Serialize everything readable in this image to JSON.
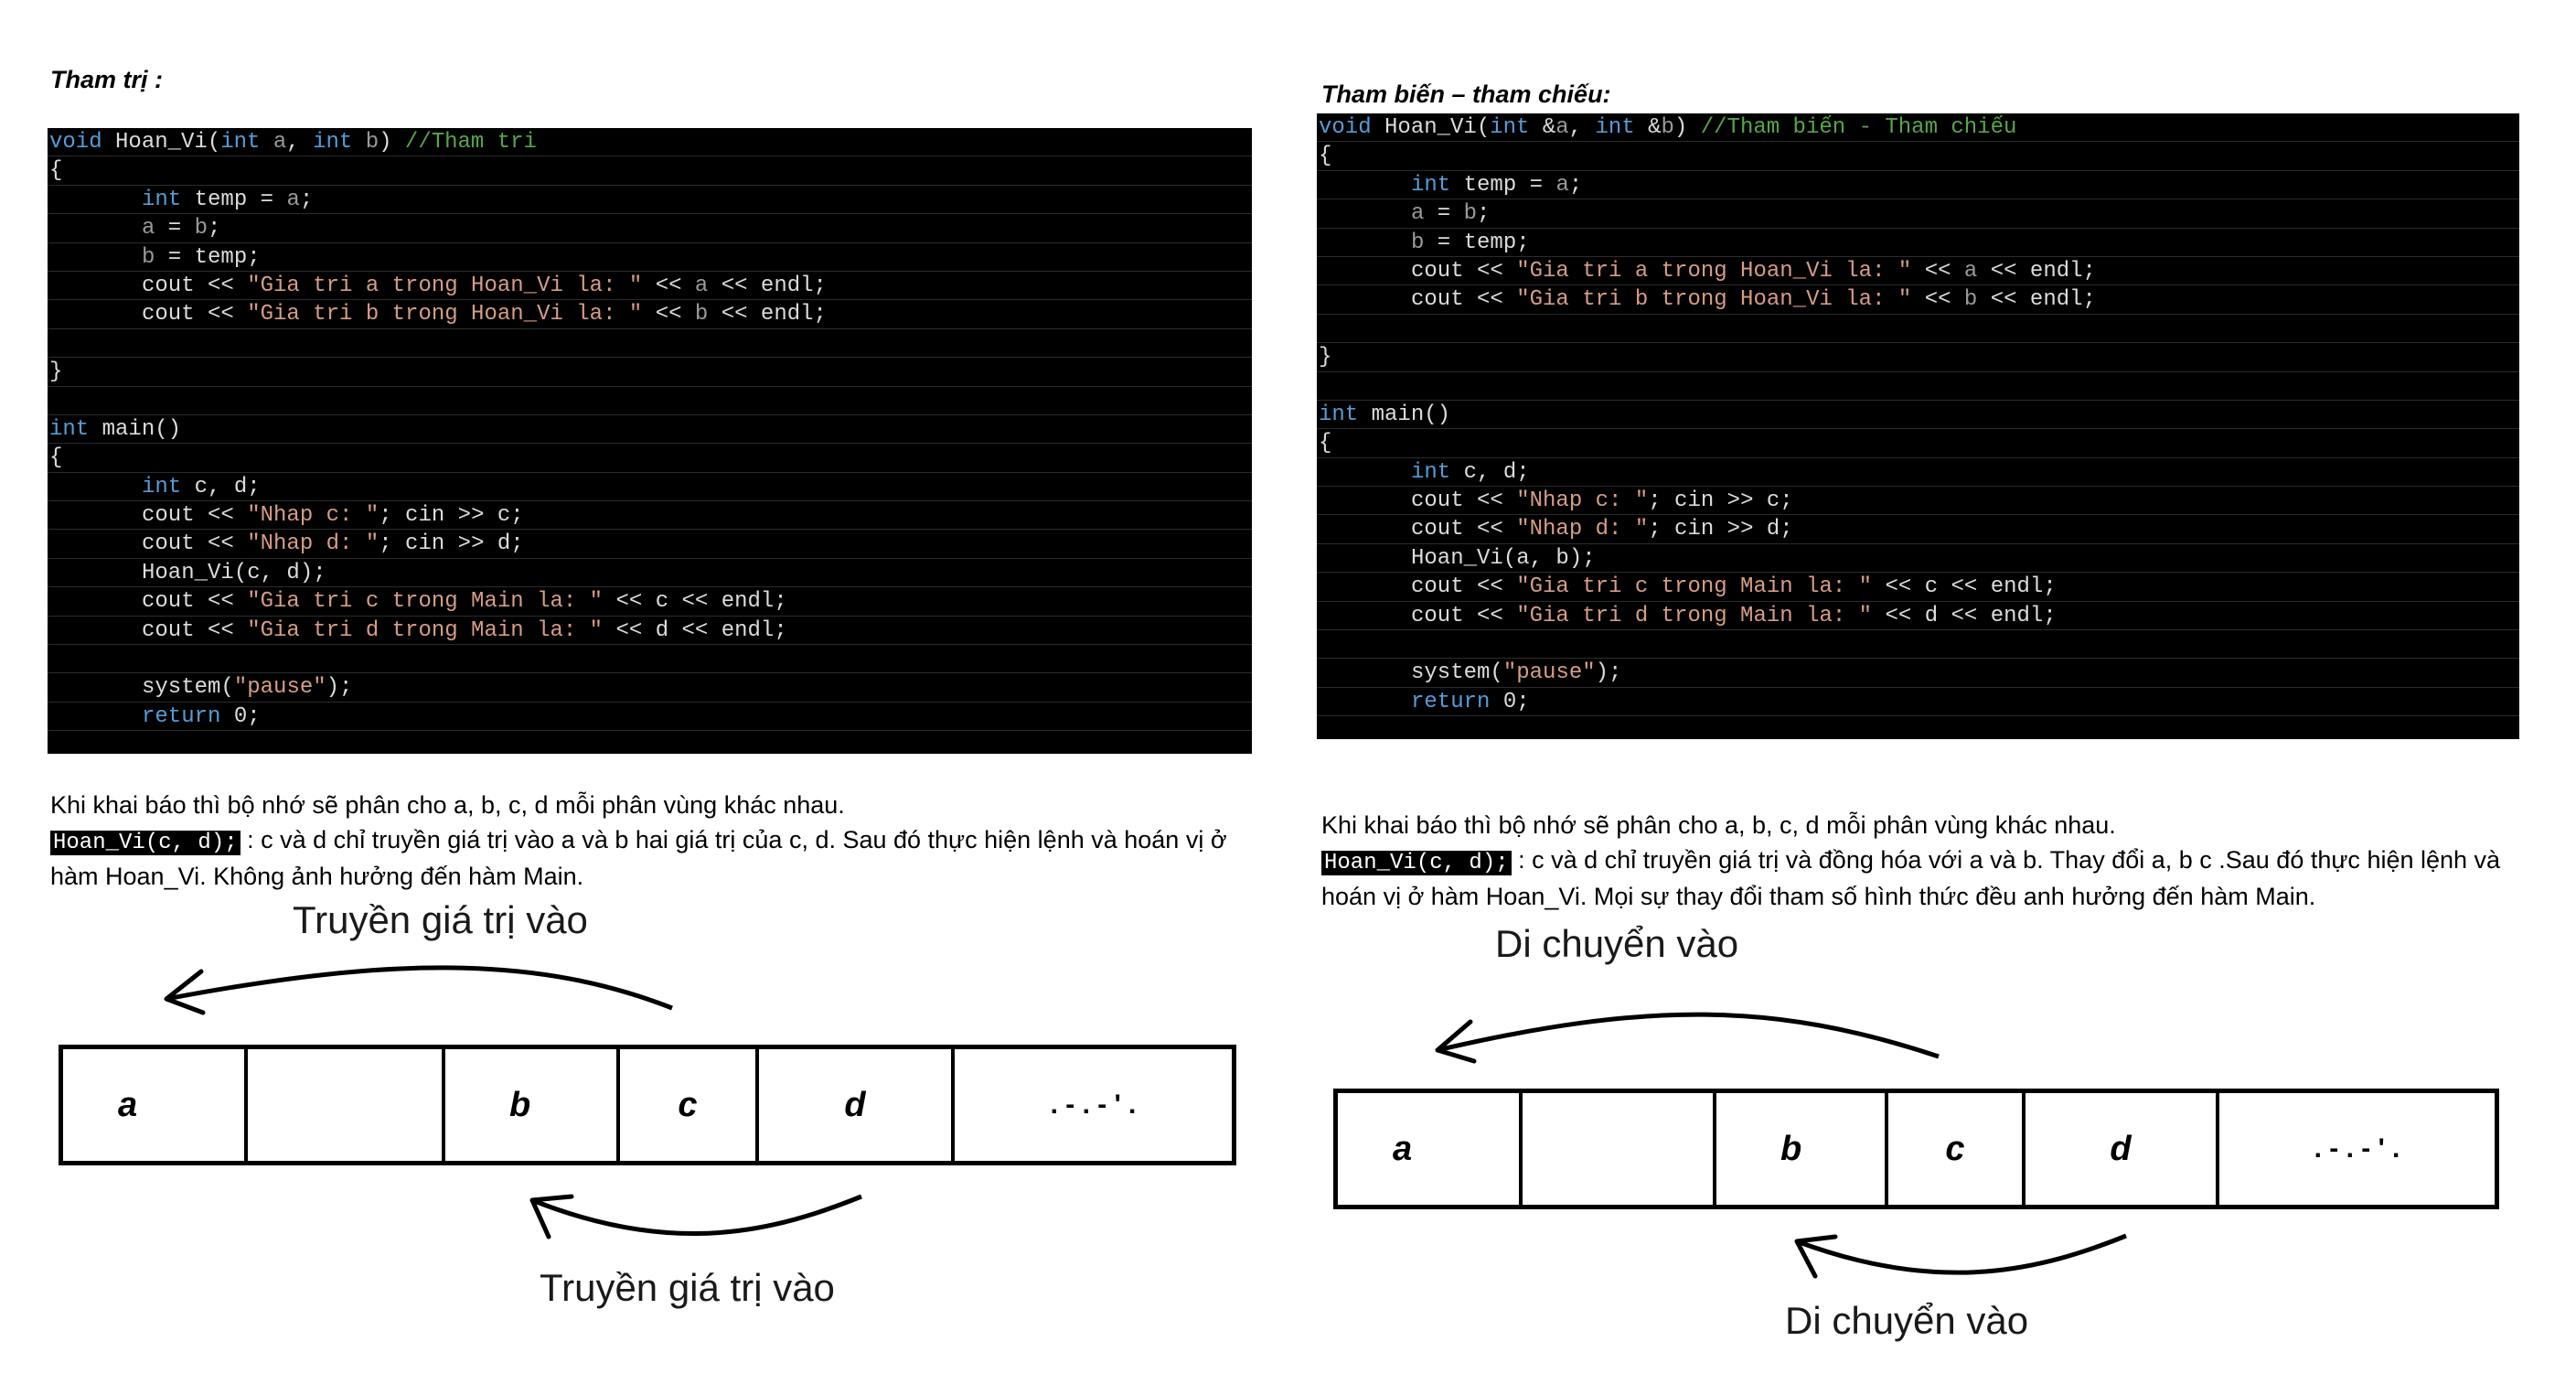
{
  "left": {
    "heading": "Tham trị :",
    "code": [
      [
        {
          "t": "void",
          "c": "kw"
        },
        {
          "t": " Hoan_Vi("
        },
        {
          "t": "int",
          "c": "kw"
        },
        {
          "t": " "
        },
        {
          "t": "a",
          "c": "par"
        },
        {
          "t": ", "
        },
        {
          "t": "int",
          "c": "kw"
        },
        {
          "t": " "
        },
        {
          "t": "b",
          "c": "par"
        },
        {
          "t": ") "
        },
        {
          "t": "//Tham tri",
          "c": "cmt"
        }
      ],
      [
        {
          "t": "{"
        }
      ],
      [
        {
          "t": "int",
          "c": "kw",
          "i": 1
        },
        {
          "t": " temp = "
        },
        {
          "t": "a",
          "c": "par"
        },
        {
          "t": ";"
        }
      ],
      [
        {
          "t": "a",
          "c": "par",
          "i": 1
        },
        {
          "t": " = "
        },
        {
          "t": "b",
          "c": "par"
        },
        {
          "t": ";"
        }
      ],
      [
        {
          "t": "b",
          "c": "par",
          "i": 1
        },
        {
          "t": " = temp;"
        }
      ],
      [
        {
          "t": "cout << ",
          "i": 1
        },
        {
          "t": "\"Gia tri a trong Hoan_Vi la: \"",
          "c": "str"
        },
        {
          "t": " << "
        },
        {
          "t": "a",
          "c": "par"
        },
        {
          "t": " << endl;"
        }
      ],
      [
        {
          "t": "cout << ",
          "i": 1
        },
        {
          "t": "\"Gia tri b trong Hoan_Vi la: \"",
          "c": "str"
        },
        {
          "t": " << "
        },
        {
          "t": "b",
          "c": "par"
        },
        {
          "t": " << endl;"
        }
      ],
      [
        {
          "t": ""
        }
      ],
      [
        {
          "t": "}"
        }
      ],
      [
        {
          "t": ""
        }
      ],
      [
        {
          "t": "int",
          "c": "kw"
        },
        {
          "t": " main()"
        }
      ],
      [
        {
          "t": "{"
        }
      ],
      [
        {
          "t": "int",
          "c": "kw",
          "i": 1
        },
        {
          "t": " c, d;"
        }
      ],
      [
        {
          "t": "cout << ",
          "i": 1
        },
        {
          "t": "\"Nhap c: \"",
          "c": "str"
        },
        {
          "t": "; cin >> c;"
        }
      ],
      [
        {
          "t": "cout << ",
          "i": 1
        },
        {
          "t": "\"Nhap d: \"",
          "c": "str"
        },
        {
          "t": "; cin >> d;"
        }
      ],
      [
        {
          "t": "Hoan_Vi(c, d);",
          "i": 1
        }
      ],
      [
        {
          "t": "cout << ",
          "i": 1
        },
        {
          "t": "\"Gia tri c trong Main la: \"",
          "c": "str"
        },
        {
          "t": " << c << endl;"
        }
      ],
      [
        {
          "t": "cout << ",
          "i": 1
        },
        {
          "t": "\"Gia tri d trong Main la: \"",
          "c": "str"
        },
        {
          "t": " << d << endl;"
        }
      ],
      [
        {
          "t": ""
        }
      ],
      [
        {
          "t": "system(",
          "i": 1
        },
        {
          "t": "\"pause\"",
          "c": "str"
        },
        {
          "t": ");"
        }
      ],
      [
        {
          "t": "return",
          "c": "kw",
          "i": 1
        },
        {
          "t": " 0;"
        }
      ]
    ],
    "para_line1": "Khi khai báo thì bộ nhớ sẽ phân cho a, b, c, d mỗi phân vùng khác nhau.",
    "para_code": "Hoan_Vi(c, d);",
    "para_rest": " : c và d chỉ truyền giá trị vào a và b hai giá trị của c, d. Sau đó thực hiện lệnh và hoán vị ở hàm Hoan_Vi. Không ảnh hưởng đến hàm Main.",
    "label_top": "Truyền giá trị vào",
    "label_bottom": "Truyền giá trị vào",
    "cells": [
      "a",
      "",
      "b",
      "c",
      "d",
      ". - . - ' ."
    ]
  },
  "right": {
    "heading": "Tham biến – tham chiếu:",
    "code": [
      [
        {
          "t": "void",
          "c": "kw"
        },
        {
          "t": " Hoan_Vi("
        },
        {
          "t": "int",
          "c": "kw"
        },
        {
          "t": " &"
        },
        {
          "t": "a",
          "c": "par"
        },
        {
          "t": ", "
        },
        {
          "t": "int",
          "c": "kw"
        },
        {
          "t": " &"
        },
        {
          "t": "b",
          "c": "par"
        },
        {
          "t": ") "
        },
        {
          "t": "//Tham biến - Tham chiếu",
          "c": "cmt"
        }
      ],
      [
        {
          "t": "{"
        }
      ],
      [
        {
          "t": "int",
          "c": "kw",
          "i": 1
        },
        {
          "t": " temp = "
        },
        {
          "t": "a",
          "c": "par"
        },
        {
          "t": ";"
        }
      ],
      [
        {
          "t": "a",
          "c": "par",
          "i": 1
        },
        {
          "t": " = "
        },
        {
          "t": "b",
          "c": "par"
        },
        {
          "t": ";"
        }
      ],
      [
        {
          "t": "b",
          "c": "par",
          "i": 1
        },
        {
          "t": " = temp;"
        }
      ],
      [
        {
          "t": "cout << ",
          "i": 1
        },
        {
          "t": "\"Gia tri a trong Hoan_Vi la: \"",
          "c": "str"
        },
        {
          "t": " << "
        },
        {
          "t": "a",
          "c": "par"
        },
        {
          "t": " << endl;"
        }
      ],
      [
        {
          "t": "cout << ",
          "i": 1
        },
        {
          "t": "\"Gia tri b trong Hoan_Vi la: \"",
          "c": "str"
        },
        {
          "t": " << "
        },
        {
          "t": "b",
          "c": "par"
        },
        {
          "t": " << endl;"
        }
      ],
      [
        {
          "t": ""
        }
      ],
      [
        {
          "t": "}"
        }
      ],
      [
        {
          "t": ""
        }
      ],
      [
        {
          "t": "int",
          "c": "kw"
        },
        {
          "t": " main()"
        }
      ],
      [
        {
          "t": "{"
        }
      ],
      [
        {
          "t": "int",
          "c": "kw",
          "i": 1
        },
        {
          "t": " c, d;"
        }
      ],
      [
        {
          "t": "cout << ",
          "i": 1
        },
        {
          "t": "\"Nhap c: \"",
          "c": "str"
        },
        {
          "t": "; cin >> c;"
        }
      ],
      [
        {
          "t": "cout << ",
          "i": 1
        },
        {
          "t": "\"Nhap d: \"",
          "c": "str"
        },
        {
          "t": "; cin >> d;"
        }
      ],
      [
        {
          "t": "Hoan_Vi(a, b);",
          "i": 1
        }
      ],
      [
        {
          "t": "cout << ",
          "i": 1
        },
        {
          "t": "\"Gia tri c trong Main la: \"",
          "c": "str"
        },
        {
          "t": " << c << endl;"
        }
      ],
      [
        {
          "t": "cout << ",
          "i": 1
        },
        {
          "t": "\"Gia tri d trong Main la: \"",
          "c": "str"
        },
        {
          "t": " << d << endl;"
        }
      ],
      [
        {
          "t": ""
        }
      ],
      [
        {
          "t": "system(",
          "i": 1
        },
        {
          "t": "\"pause\"",
          "c": "str"
        },
        {
          "t": ");"
        }
      ],
      [
        {
          "t": "return",
          "c": "kw",
          "i": 1
        },
        {
          "t": " 0;"
        }
      ]
    ],
    "para_line1": "Khi khai báo thì bộ nhớ sẽ phân cho a, b, c, d mỗi phân vùng khác nhau.",
    "para_code": "Hoan_Vi(c, d);",
    "para_rest": " : c và d chỉ truyền giá trị và đồng hóa với a và b. Thay đổi a, b c .Sau đó thực hiện lệnh và hoán vị ở hàm Hoan_Vi. Mọi sự thay đổi tham số hình thức đều anh hưởng đến hàm Main.",
    "label_top": "Di chuyển vào",
    "label_bottom": "Di chuyển vào",
    "cells": [
      "a",
      "",
      "b",
      "c",
      "d",
      ". - . - ' ."
    ]
  },
  "colors": {
    "keyword": "#569cd6",
    "string": "#d69d85",
    "comment": "#57a64a",
    "code_bg": "#000000"
  }
}
